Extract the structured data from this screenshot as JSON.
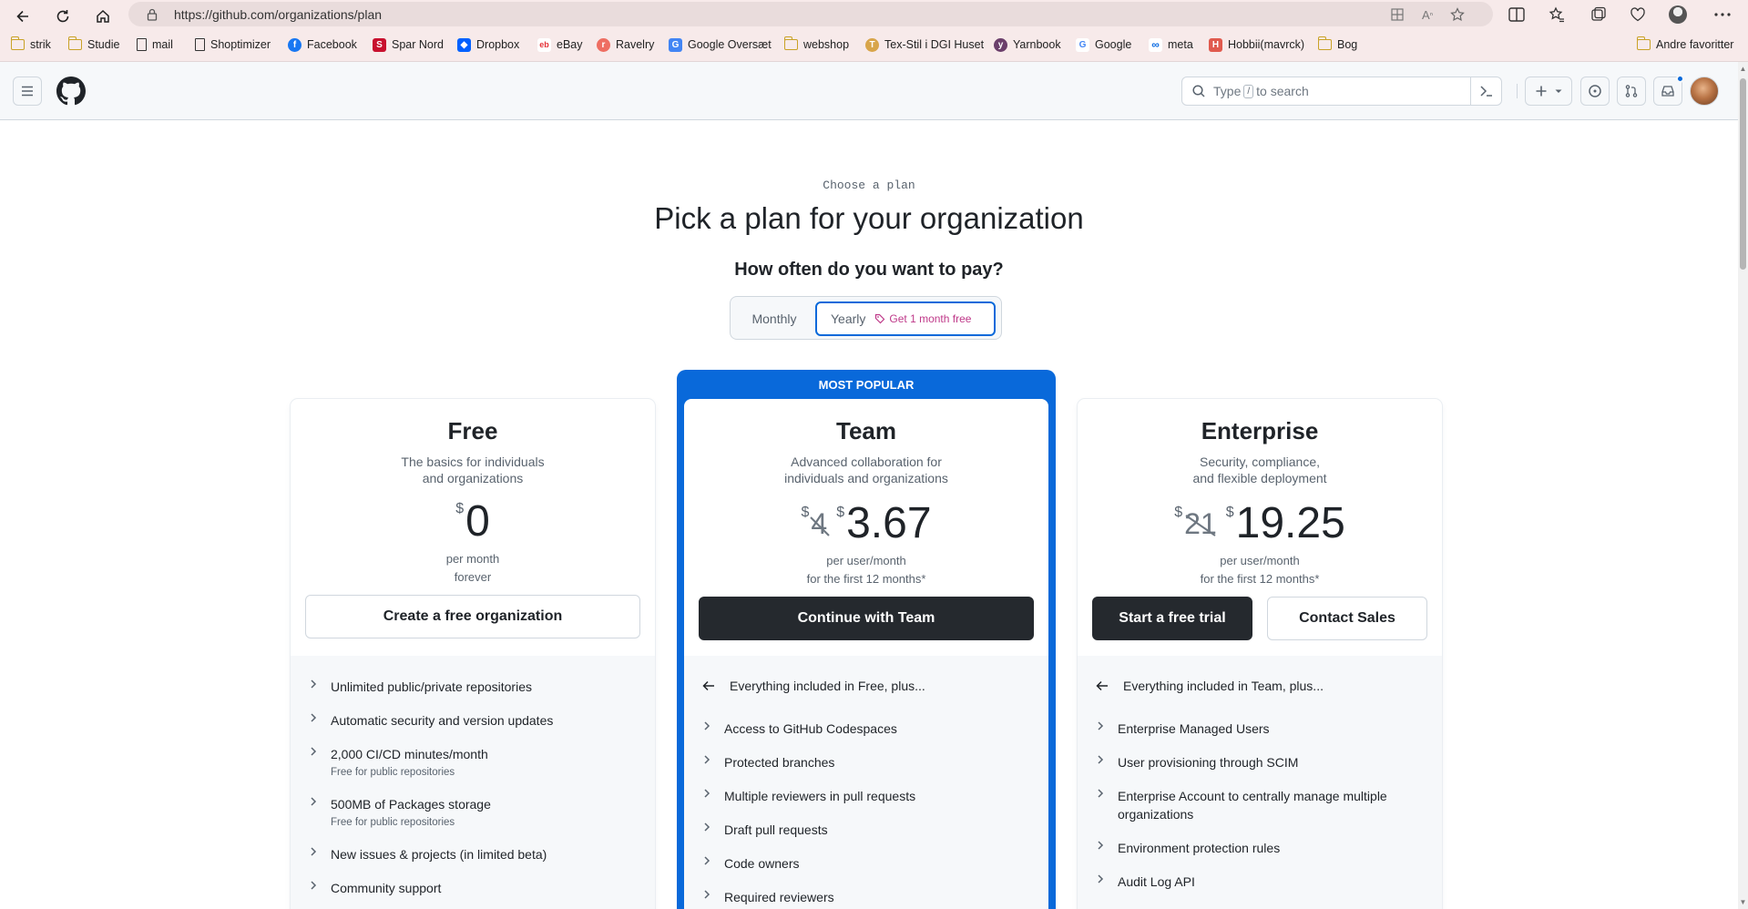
{
  "browser": {
    "url": "https://github.com/organizations/plan",
    "bookmarks": [
      {
        "label": "strik",
        "icon": "folder-icon"
      },
      {
        "label": "Studie",
        "icon": "folder-icon"
      },
      {
        "label": "mail",
        "icon": "page-icon"
      },
      {
        "label": "Shoptimizer",
        "icon": "page-icon"
      },
      {
        "label": "Facebook",
        "icon": "facebook-icon"
      },
      {
        "label": "Spar Nord",
        "icon": "sparnord-icon"
      },
      {
        "label": "Dropbox",
        "icon": "dropbox-icon"
      },
      {
        "label": "eBay",
        "icon": "ebay-icon"
      },
      {
        "label": "Ravelry",
        "icon": "ravelry-icon"
      },
      {
        "label": "Google Oversæt",
        "icon": "google-translate-icon"
      },
      {
        "label": "webshop",
        "icon": "folder-icon"
      },
      {
        "label": "Tex-Stil i DGI Huset",
        "icon": "texstil-icon"
      },
      {
        "label": "Yarnbook",
        "icon": "yarnbook-icon"
      },
      {
        "label": "Google",
        "icon": "google-icon"
      },
      {
        "label": "meta",
        "icon": "meta-icon"
      },
      {
        "label": "Hobbii(mavrck)",
        "icon": "hobbii-icon"
      },
      {
        "label": "Bog",
        "icon": "folder-icon"
      }
    ],
    "other_favorites": "Andre favoritter"
  },
  "header": {
    "search_placeholder_pre": "Type",
    "search_key": "/",
    "search_placeholder_post": "to search"
  },
  "page": {
    "eyebrow": "Choose a plan",
    "title": "Pick a plan for your organization",
    "question": "How often do you want to pay?",
    "billing": {
      "monthly": "Monthly",
      "yearly": "Yearly",
      "yearly_promo": "Get 1 month free",
      "selected": "Yearly"
    }
  },
  "plans": {
    "free": {
      "name": "Free",
      "desc_line1": "The basics for individuals",
      "desc_line2": "and organizations",
      "currency": "$",
      "price": "0",
      "per_line1": "per month",
      "per_line2": "forever",
      "cta": "Create a free organization",
      "features": [
        {
          "text": "Unlimited public/private repositories",
          "sub": ""
        },
        {
          "text": "Automatic security and version updates",
          "sub": ""
        },
        {
          "text": "2,000 CI/CD minutes/month",
          "sub": "Free for public repositories"
        },
        {
          "text": "500MB of Packages storage",
          "sub": "Free for public repositories"
        },
        {
          "text": "New issues & projects (in limited beta)",
          "sub": ""
        },
        {
          "text": "Community support",
          "sub": ""
        }
      ]
    },
    "team": {
      "badge": "MOST POPULAR",
      "name": "Team",
      "desc_line1": "Advanced collaboration for",
      "desc_line2": "individuals and organizations",
      "currency": "$",
      "old_price": "4",
      "price": "3.67",
      "per_line1": "per user/month",
      "per_line2": "for the first 12 months*",
      "cta": "Continue with Team",
      "includes": "Everything included in Free, plus...",
      "features": [
        "Access to GitHub Codespaces",
        "Protected branches",
        "Multiple reviewers in pull requests",
        "Draft pull requests",
        "Code owners",
        "Required reviewers"
      ]
    },
    "enterprise": {
      "name": "Enterprise",
      "desc_line1": "Security, compliance,",
      "desc_line2": "and flexible deployment",
      "currency": "$",
      "old_price": "21",
      "price": "19.25",
      "per_line1": "per user/month",
      "per_line2": "for the first 12 months*",
      "cta_primary": "Start a free trial",
      "cta_secondary": "Contact Sales",
      "includes": "Everything included in Team, plus...",
      "features": [
        "Enterprise Managed Users",
        "User provisioning through SCIM",
        "Enterprise Account to centrally manage multiple organizations",
        "Environment protection rules",
        "Audit Log API"
      ]
    }
  },
  "colors": {
    "accent": "#0969da",
    "promo": "#bf3989",
    "dark_button": "#25292e"
  }
}
